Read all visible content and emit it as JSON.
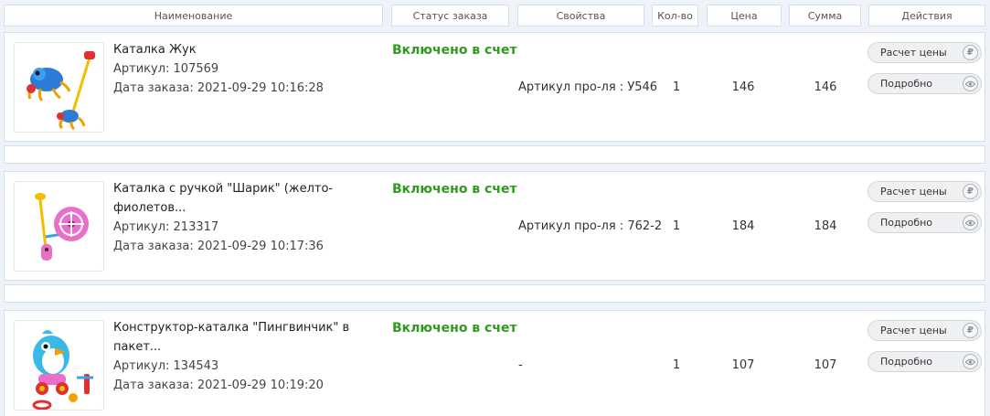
{
  "columns": {
    "name": "Наименование",
    "status": "Статус заказа",
    "props": "Свойства",
    "qty": "Кол-во",
    "price": "Цена",
    "sum": "Сумма",
    "actions": "Действия"
  },
  "buttons": {
    "price_calc": "Расчет цены",
    "details": "Подробно",
    "ruble_icon": "₽",
    "eye_icon": "eye-icon"
  },
  "rows": [
    {
      "name_line1": "Каталка Жук",
      "name_line2": "",
      "article": "Артикул: 107569",
      "date": "Дата заказа: 2021-09-29 10:16:28",
      "status": "Включено в счет",
      "props": "Артикул про-ля : У546",
      "qty": "1",
      "price": "146",
      "sum": "146"
    },
    {
      "name_line1": "Каталка с ручкой \"Шарик\" (желто-",
      "name_line2": "фиолетов...",
      "article": "Артикул: 213317",
      "date": "Дата заказа: 2021-09-29 10:17:36",
      "status": "Включено в счет",
      "props": "Артикул про-ля : 762-2",
      "qty": "1",
      "price": "184",
      "sum": "184"
    },
    {
      "name_line1": "Конструктор-каталка \"Пингвинчик\" в",
      "name_line2": "пакет...",
      "article": "Артикул: 134543",
      "date": "Дата заказа: 2021-09-29 10:19:20",
      "status": "Включено в счет",
      "props": "-",
      "qty": "1",
      "price": "107",
      "sum": "107"
    }
  ],
  "colors": {
    "status_green": "#2e9b1c",
    "border": "#d4dfeb",
    "background": "#eef3f9"
  }
}
